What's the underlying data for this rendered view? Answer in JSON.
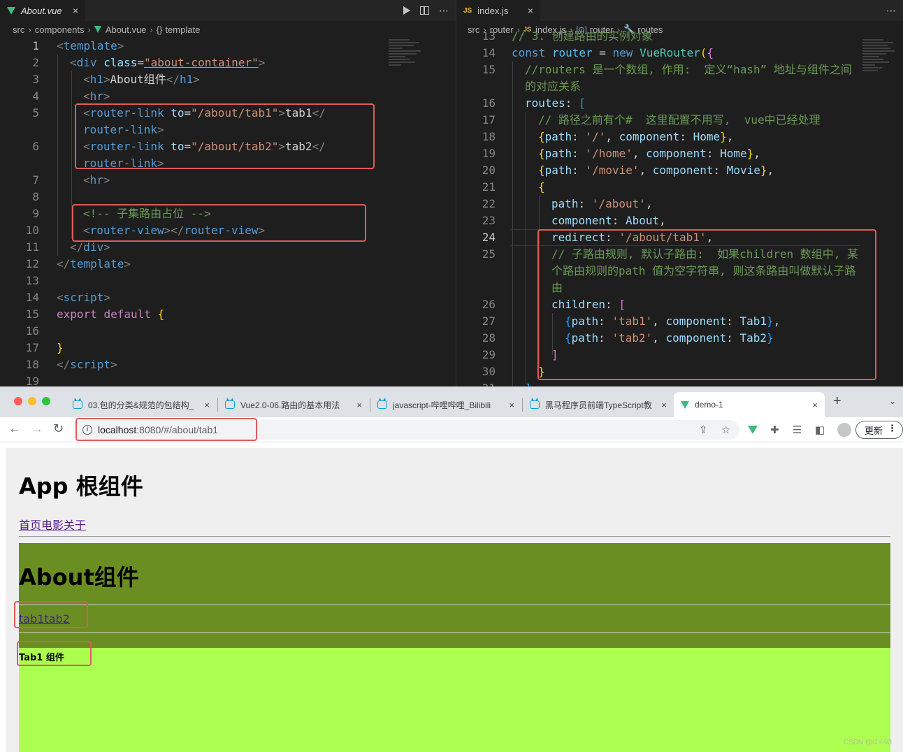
{
  "editor_left": {
    "tab": {
      "label": "About.vue",
      "close": "×"
    },
    "breadcrumb": [
      "src",
      "components",
      "About.vue",
      "template"
    ],
    "line_numbers": [
      "1",
      "2",
      "3",
      "4",
      "5",
      "",
      "6",
      "",
      "7",
      "8",
      "9",
      "10",
      "11",
      "12",
      "13",
      "14",
      "15",
      "16",
      "17",
      "18",
      "19"
    ],
    "code": {
      "l1": [
        "<",
        "template",
        ">"
      ],
      "l2": [
        "<",
        "div",
        "class",
        "=",
        "\"about-container\"",
        ">"
      ],
      "l3": [
        "<",
        "h1",
        ">",
        "About组件",
        "</",
        "h1",
        ">"
      ],
      "l4": [
        "<",
        "hr",
        ">"
      ],
      "l5a": [
        "<",
        "router-link",
        "to",
        "=",
        "\"/about/tab1\"",
        ">",
        "tab1",
        "</"
      ],
      "l5b": [
        "router-link",
        ">"
      ],
      "l6a": [
        "<",
        "router-link",
        "to",
        "=",
        "\"/about/tab2\"",
        ">",
        "tab2",
        "</"
      ],
      "l6b": [
        "router-link",
        ">"
      ],
      "l7": [
        "<",
        "hr",
        ">"
      ],
      "l9": "<!-- 子集路由占位 -->",
      "l10": [
        "<",
        "router-view",
        "></",
        "router-view",
        ">"
      ],
      "l11": [
        "</",
        "div",
        ">"
      ],
      "l12": [
        "</",
        "template",
        ">"
      ],
      "l14": [
        "<",
        "script",
        ">"
      ],
      "l15": [
        "export",
        "default",
        "{"
      ],
      "l17": "}",
      "l18": [
        "</",
        "script",
        ">"
      ]
    }
  },
  "editor_right": {
    "tab": {
      "label": "index.js",
      "badge": "JS",
      "close": "×"
    },
    "breadcrumb": [
      "src",
      "router",
      "index.js",
      "router",
      "routes"
    ],
    "line_numbers": [
      "13",
      "14",
      "15",
      "",
      "16",
      "17",
      "18",
      "19",
      "20",
      "21",
      "22",
      "23",
      "24",
      "25",
      "",
      "",
      "26",
      "27",
      "28",
      "29",
      "30",
      "31"
    ],
    "active_line": "24",
    "code": {
      "l13": "// 3. 创建路由的实例对象",
      "l14": [
        "const",
        "router",
        "=",
        "new",
        "VueRouter",
        "(",
        "{"
      ],
      "l15a": "//routers 是一个数组, 作用:  定义“hash” 地址与组件之间",
      "l15b": "的对应关系",
      "l16": [
        "routes",
        ":",
        "["
      ],
      "l17": "// 路径之前有个#  这里配置不用写,  vue中已经处理",
      "l18": [
        "{",
        "path",
        ": ",
        "'/'",
        ", ",
        "component",
        ": ",
        "Home",
        "}",
        ","
      ],
      "l19": [
        "{",
        "path",
        ": ",
        "'/home'",
        ", ",
        "component",
        ": ",
        "Home",
        "}",
        ","
      ],
      "l20": [
        "{",
        "path",
        ": ",
        "'/movie'",
        ", ",
        "component",
        ": ",
        "Movie",
        "}",
        ","
      ],
      "l21": "{",
      "l22": [
        "path",
        ": ",
        "'/about'",
        ","
      ],
      "l23": [
        "component",
        ": ",
        "About",
        ","
      ],
      "l24": [
        "redirect",
        ": ",
        "'/about/tab1'",
        ","
      ],
      "l25a": "// 子路由规则, 默认子路由:  如果children 数组中, 某",
      "l25b": "个路由规则的path 值为空字符串, 则这条路由叫做默认子路",
      "l25c": "由",
      "l26": [
        "children",
        ": ",
        "["
      ],
      "l27": [
        "{",
        "path",
        ": ",
        "'tab1'",
        ", ",
        "component",
        ": ",
        "Tab1",
        "}",
        ","
      ],
      "l28": [
        "{",
        "path",
        ": ",
        "'tab2'",
        ", ",
        "component",
        ": ",
        "Tab2",
        "}"
      ],
      "l29": "]",
      "l30": "}",
      "l31": "]"
    }
  },
  "browser": {
    "tabs": [
      {
        "title": "03.包的分类&规范的包结构_",
        "close": "×"
      },
      {
        "title": "Vue2.0-06.路由的基本用法",
        "close": "×"
      },
      {
        "title": "javascript-哔哩哔哩_Bilibili",
        "close": "×"
      },
      {
        "title": "黑马程序员前端TypeScript教",
        "close": "×"
      },
      {
        "title": "demo-1",
        "close": "×"
      }
    ],
    "new_tab": "+",
    "tab_menu": "⌄",
    "url_host": "localhost",
    "url_rest": ":8080/#/about/tab1",
    "update_button": "更新",
    "page": {
      "app_title": "App 根组件",
      "nav_links": "首页电影关于",
      "about_title": "About组件",
      "tab_links": "tab1tab2",
      "tab1_title": "Tab1 组件"
    }
  },
  "watermark": "CSDN @GY-93",
  "colors": {
    "editor_bg": "#1e1e1e",
    "highlight_box": "#e05a5a",
    "about_bg": "#6b8e23",
    "tab1_bg": "#adff4f",
    "app_bg": "#efefef"
  }
}
